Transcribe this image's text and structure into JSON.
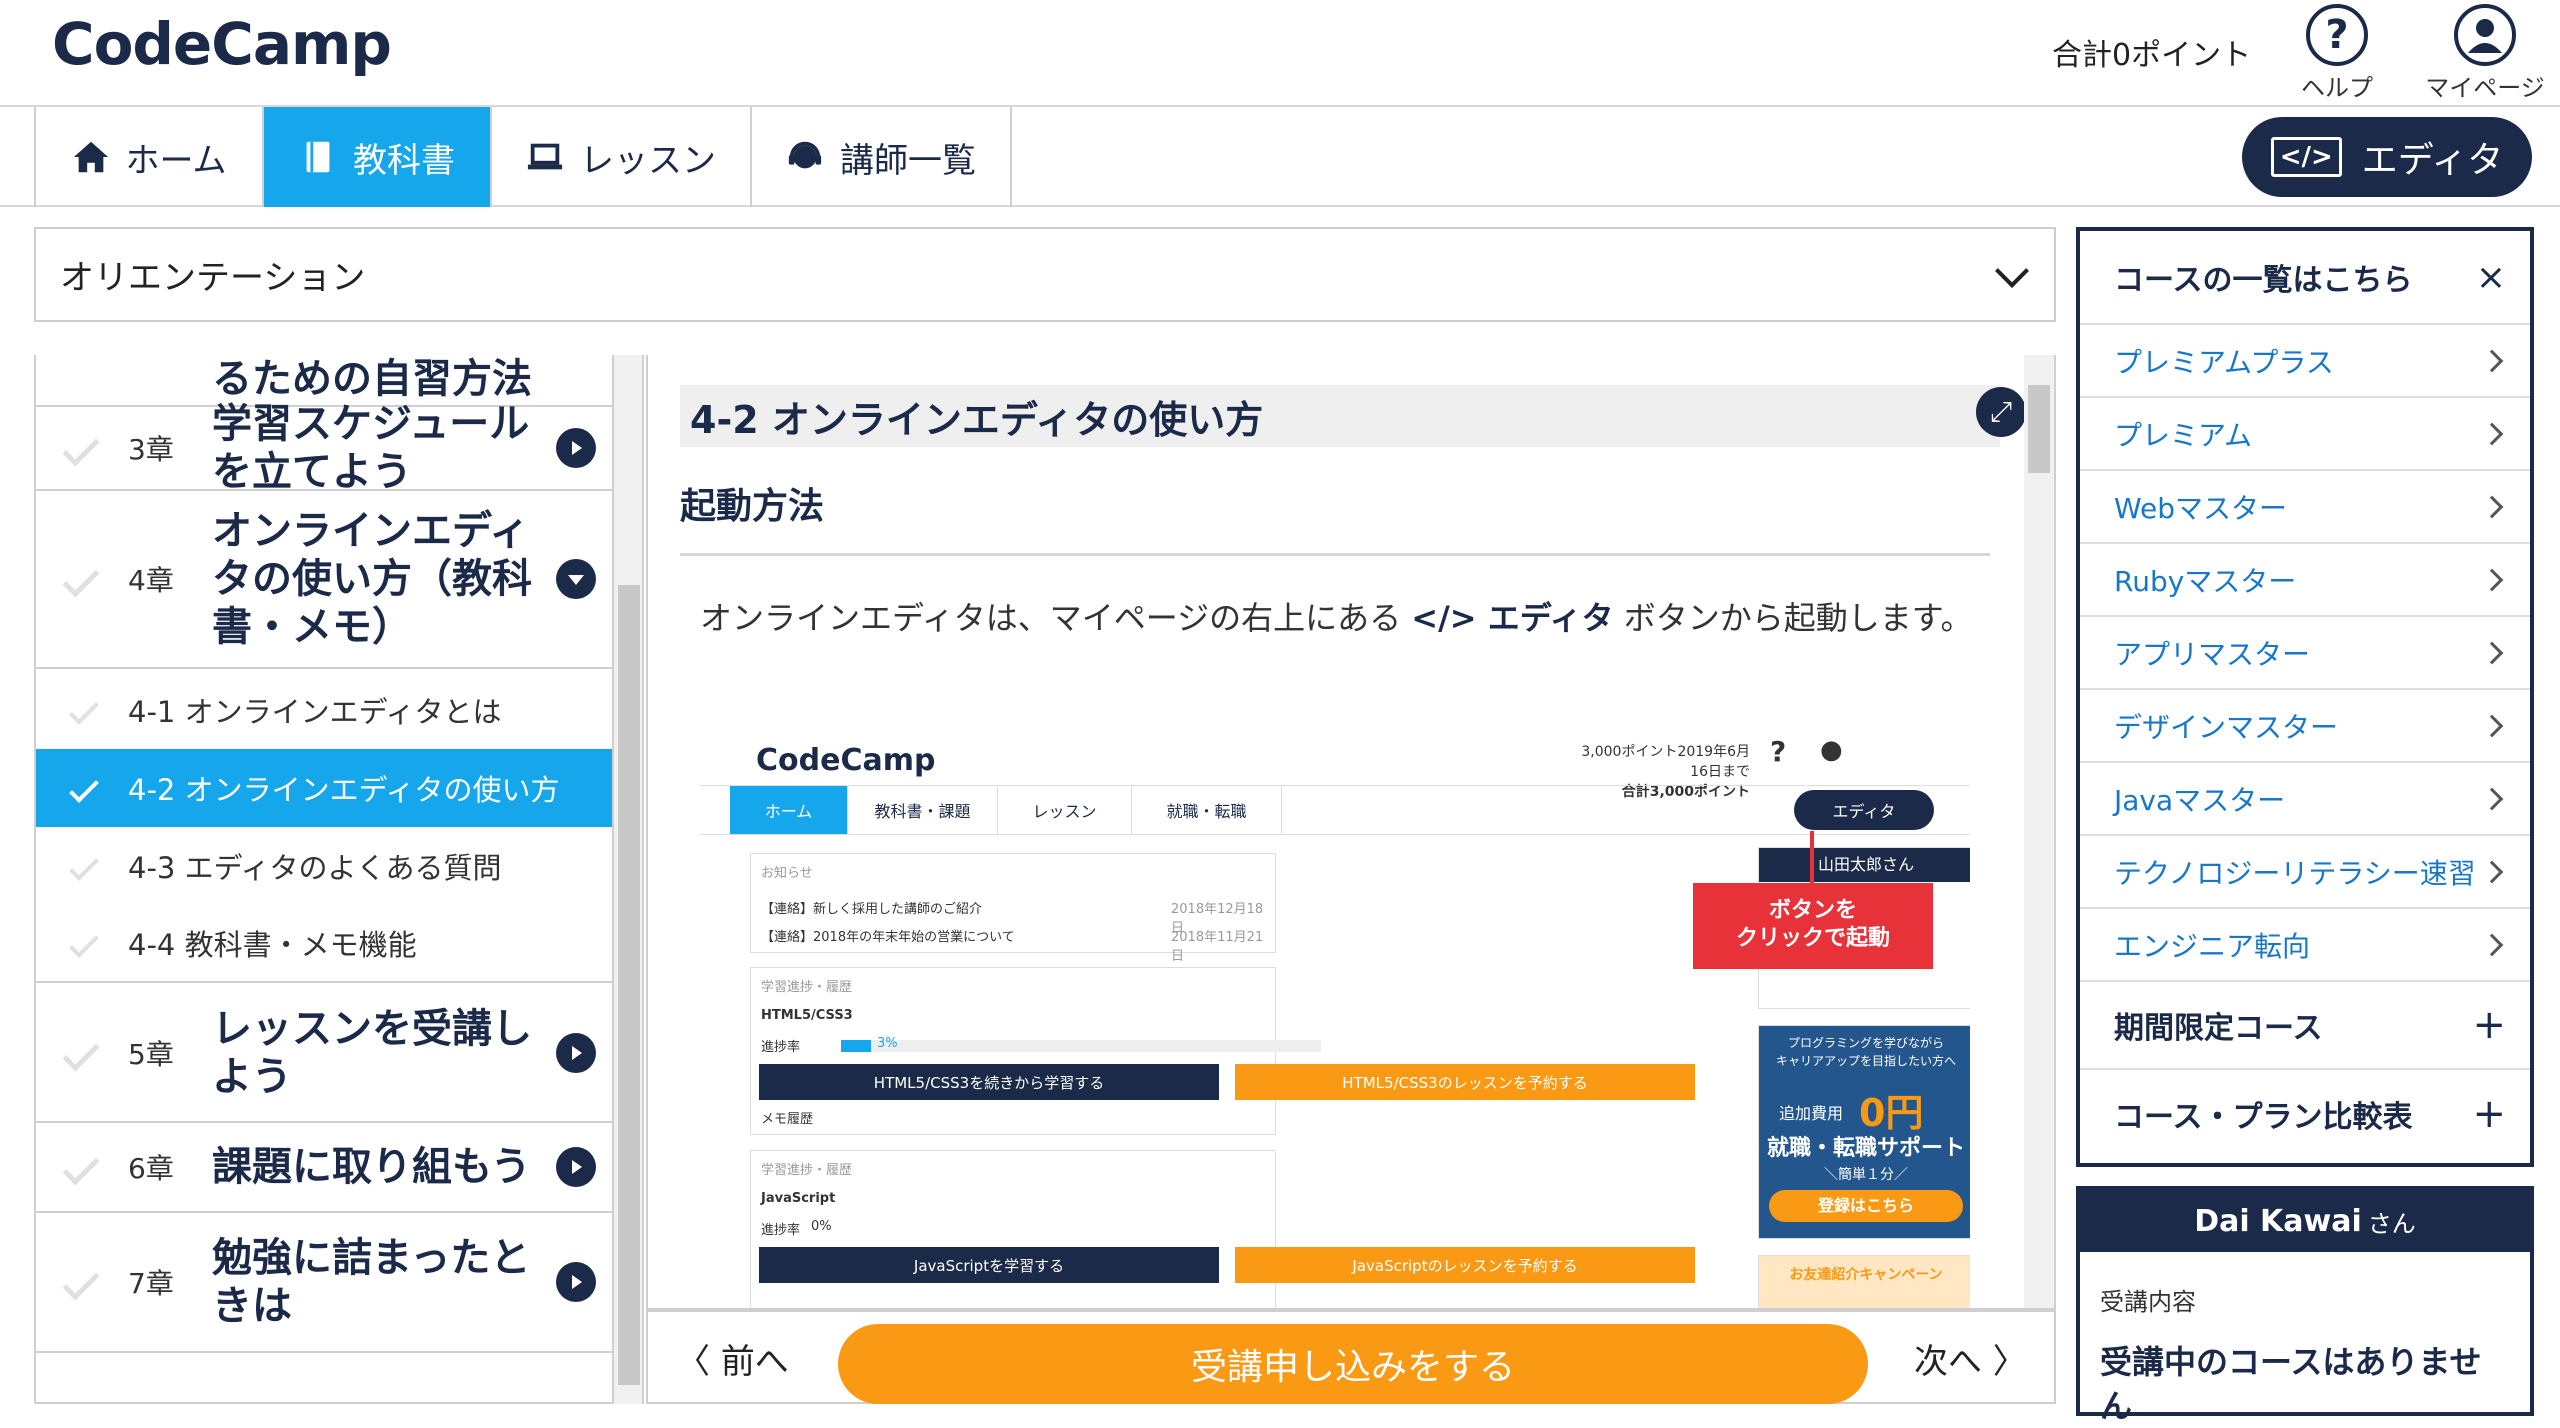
{
  "header": {
    "logo": "CodeCamp",
    "points": "合計0ポイント",
    "help_label": "ヘルプ",
    "mypage_label": "マイページ"
  },
  "nav": {
    "tabs": [
      {
        "label": "ホーム",
        "icon": "home-icon"
      },
      {
        "label": "教科書",
        "icon": "book-icon",
        "active": true
      },
      {
        "label": "レッスン",
        "icon": "laptop-icon"
      },
      {
        "label": "講師一覧",
        "icon": "headset-icon"
      }
    ],
    "editor_code": "</>",
    "editor_label": "エディタ"
  },
  "chapter_select": {
    "value": "オリエンテーション"
  },
  "toc": {
    "partial_title": "るための自習方法",
    "chapters": [
      {
        "num": "3章",
        "title": "学習スケジュールを立てよう"
      },
      {
        "num": "4章",
        "title": "オンラインエディタの使い方（教科書・メモ）"
      },
      {
        "num": "5章",
        "title": "レッスンを受講しよう"
      },
      {
        "num": "6章",
        "title": "課題に取り組もう"
      },
      {
        "num": "7章",
        "title": "勉強に詰まったときは"
      }
    ],
    "sections": [
      {
        "label": "4-1 オンラインエディタとは"
      },
      {
        "label": "4-2 オンラインエディタの使い方",
        "active": true
      },
      {
        "label": "4-3 エディタのよくある質問"
      },
      {
        "label": "4-4 教科書・メモ機能"
      }
    ]
  },
  "content": {
    "title": "4-2 オンラインエディタの使い方",
    "subtitle": "起動方法",
    "para_pre": "オンラインエディタは、マイページの右上にある ",
    "para_bold": "</> エディタ",
    "para_post": " ボタンから起動します。",
    "shot": {
      "logo": "CodeCamp",
      "points_line1": "3,000ポイント2019年6月16日まで",
      "points_line2": "合計3,000ポイント",
      "tab_home": "ホーム",
      "tab_text": "教科書・課題",
      "tab_lesson": "レッスン",
      "tab_job": "就職・転職",
      "editor": "エディタ",
      "news_head": "お知らせ",
      "news1": "【連絡】新しく採用した講師のご紹介",
      "news1_date": "2018年12月18日",
      "news2": "【連絡】2018年の年末年始の営業について",
      "news2_date": "2018年11月21日",
      "progress_head": "学習進捗・履歴",
      "course1": "HTML5/CSS3",
      "rate1": "進捗率",
      "rate1_val": "3%",
      "btn1a": "HTML5/CSS3を続きから学習する",
      "btn1b": "HTML5/CSS3のレッスンを予約する",
      "memo": "メモ履歴",
      "course2": "JavaScript",
      "rate2_val": "0%",
      "btn2a": "JavaScriptを学習する",
      "btn2b": "JavaScriptのレッスンを予約する",
      "user": "山田太郎",
      "user_suffix": "さん",
      "callout_l1": "ボタンを",
      "callout_l2": "クリックで起動",
      "banner_l1": "プログラミングを学びながら",
      "banner_l2": "キャリアアップを目指したい方へ",
      "banner_fee": "追加費用",
      "banner_zero": "0円",
      "banner_main": "就職・転職サポート",
      "banner_easy": "＼簡単１分／",
      "banner_btn": "登録はこちら",
      "banner2": "お友達紹介キャンペーン"
    }
  },
  "bottom": {
    "prev": "前へ",
    "apply": "受講申し込みをする",
    "next": "次へ"
  },
  "courses": {
    "header": "コースの一覧はこちら",
    "close": "×",
    "items": [
      "プレミアムプラス",
      "プレミアム",
      "Webマスター",
      "Rubyマスター",
      "アプリマスター",
      "デザインマスター",
      "Javaマスター",
      "テクノロジーリテラシー速習",
      "エンジニア転向"
    ],
    "expanders": [
      "期間限定コース",
      "コース・プラン比較表"
    ]
  },
  "user": {
    "name": "Dai Kawai",
    "suffix": "さん",
    "label": "受講内容",
    "value": "受講中のコースはありません"
  },
  "colors": {
    "navy": "#1b2a48",
    "accent": "#16a6ec",
    "orange": "#fa9a14",
    "link": "#1877c8",
    "alert": "#e8323a"
  }
}
